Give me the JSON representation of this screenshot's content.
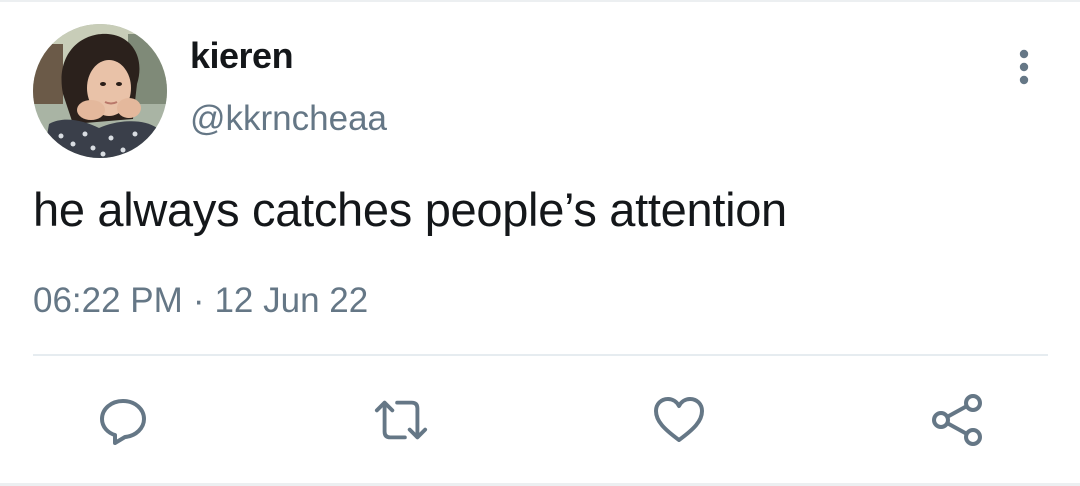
{
  "tweet": {
    "author_name": "kieren",
    "author_handle": "@kkrncheaa",
    "text": "he always catches people’s attention",
    "time": "06:22 PM",
    "separator": "·",
    "date": "12 Jun 22"
  },
  "icons": {
    "more": "more-vertical-icon",
    "reply": "reply-icon",
    "retweet": "retweet-icon",
    "like": "like-icon",
    "share": "share-icon"
  },
  "colors": {
    "text_primary": "#14171a",
    "text_secondary": "#657786",
    "icon": "#657786",
    "divider": "#e6ecf0"
  }
}
